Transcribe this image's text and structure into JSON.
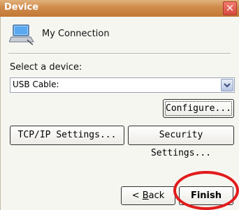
{
  "window": {
    "title": "Device",
    "close_glyph": "×"
  },
  "connection": {
    "icon": "laptop-connection-icon",
    "name": "My Connection"
  },
  "device_select": {
    "label": "Select a device:",
    "value": "USB Cable:",
    "icon": "chevron-down-icon"
  },
  "buttons": {
    "configure": "Configure...",
    "tcpip": "TCP/IP Settings...",
    "security": "Security Settings...",
    "back_prefix": "< ",
    "back_mnemonic": "B",
    "back_rest": "ack",
    "finish": "Finish"
  },
  "colors": {
    "title_bar": "#cf8a4a",
    "annotation": "#e21b1b",
    "panel": "#f6f6f1"
  }
}
